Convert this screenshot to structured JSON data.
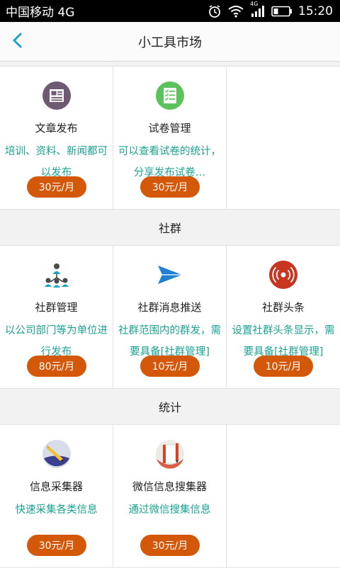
{
  "status_bar": {
    "carrier": "中国移动 4G",
    "network_badge": "4G",
    "time": "15:20",
    "icons": [
      "alarm-icon",
      "wifi-icon",
      "signal-icon",
      "battery-icon"
    ]
  },
  "nav": {
    "title": "小工具市场",
    "back_icon": "chevron-left-icon",
    "accent_color": "#1aa3c8"
  },
  "colors": {
    "price_button": "#d4580a",
    "description_text": "#1aa291"
  },
  "sections": [
    {
      "title": "",
      "tools": [
        {
          "name": "文章发布",
          "desc": "培训、资料、新闻都可以发布",
          "price": "30元/月",
          "icon": "article-icon"
        },
        {
          "name": "试卷管理",
          "desc": "可以查看试卷的统计，分享发布试卷…",
          "price": "30元/月",
          "icon": "exam-checklist-icon"
        }
      ]
    },
    {
      "title": "社群",
      "tools": [
        {
          "name": "社群管理",
          "desc": "以公司部门等为单位进行发布",
          "price": "80元/月",
          "icon": "org-chart-icon"
        },
        {
          "name": "社群消息推送",
          "desc": "社群范围内的群发，需要具备[社群管理]",
          "price": "10元/月",
          "icon": "paper-plane-icon"
        },
        {
          "name": "社群头条",
          "desc": "设置社群头条显示，需要具备[社群管理]",
          "price": "10元/月",
          "icon": "broadcast-icon"
        }
      ]
    },
    {
      "title": "统计",
      "tools": [
        {
          "name": "信息采集器",
          "desc": "快速采集各类信息",
          "price": "30元/月",
          "icon": "pencil-collector-icon"
        },
        {
          "name": "微信信息搜集器",
          "desc": "通过微信搜集信息",
          "price": "30元/月",
          "icon": "notebook-pencil-icon"
        }
      ]
    }
  ]
}
